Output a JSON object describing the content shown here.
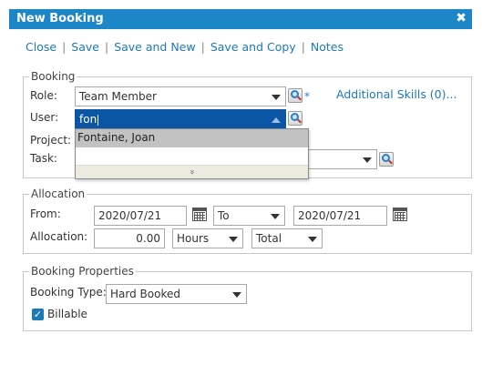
{
  "dialog": {
    "title": "New Booking",
    "close_glyph": "✖"
  },
  "toolbar": {
    "close": "Close",
    "save": "Save",
    "save_and_new": "Save and New",
    "save_and_copy": "Save and Copy",
    "notes": "Notes",
    "separator": "|"
  },
  "booking": {
    "legend": "Booking",
    "role_label": "Role:",
    "role_value": "Team Member",
    "required_marker": "*",
    "additional_skills": "Additional Skills (0)...",
    "user_label": "User:",
    "user_value": "fon",
    "project_label": "Project:",
    "task_label": "Task:"
  },
  "user_dropdown": {
    "options": [
      "Fontaine, Joan"
    ],
    "more_glyph": "»"
  },
  "allocation": {
    "legend": "Allocation",
    "from_label": "From:",
    "from_date": "2020/07/21",
    "range_select": "To",
    "to_date": "2020/07/21",
    "allocation_label": "Allocation:",
    "amount": "0.00",
    "unit_select": "Hours",
    "mode_select": "Total"
  },
  "properties": {
    "legend": "Booking Properties",
    "type_label": "Booking Type:",
    "type_value": "Hard Booked",
    "billable_label": "Billable",
    "billable_checked": true
  },
  "colors": {
    "accent": "#1d86c9",
    "link": "#1d7ab8",
    "active_field": "#0a56a5"
  }
}
